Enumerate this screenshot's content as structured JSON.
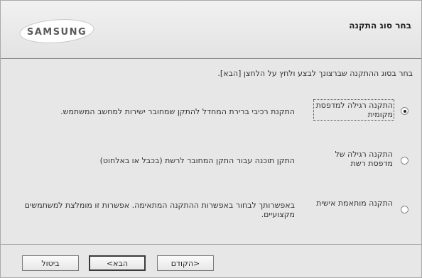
{
  "header": {
    "logo_text": "SAMSUNG",
    "title": "בחר סוג התקנה"
  },
  "instruction": "בחר בסוג ההתקנה שברצונך לבצע ולחץ על הלחצן [הבא].",
  "options": [
    {
      "label": "התקנה רגילה למדפסת מקומית",
      "description": "התקנת רכיבי ברירת המחדל להתקן שמחובר ישירות למחשב המשתמש.",
      "selected": true
    },
    {
      "label": "התקנה רגילה של מדפסת רשת",
      "description": "התקן תוכנה עבור התקן המחובר לרשת (בכבל או באלחוט)",
      "selected": false
    },
    {
      "label": "התקנה מותאמת אישית",
      "description": "באפשרותך לבחור באפשרות ההתקנה המתאימה. אפשרות זו מומלצת למשתמשים מקצועיים.",
      "selected": false
    }
  ],
  "buttons": {
    "cancel": "ביטול",
    "next": "הבא>",
    "back": "<הקודם"
  }
}
